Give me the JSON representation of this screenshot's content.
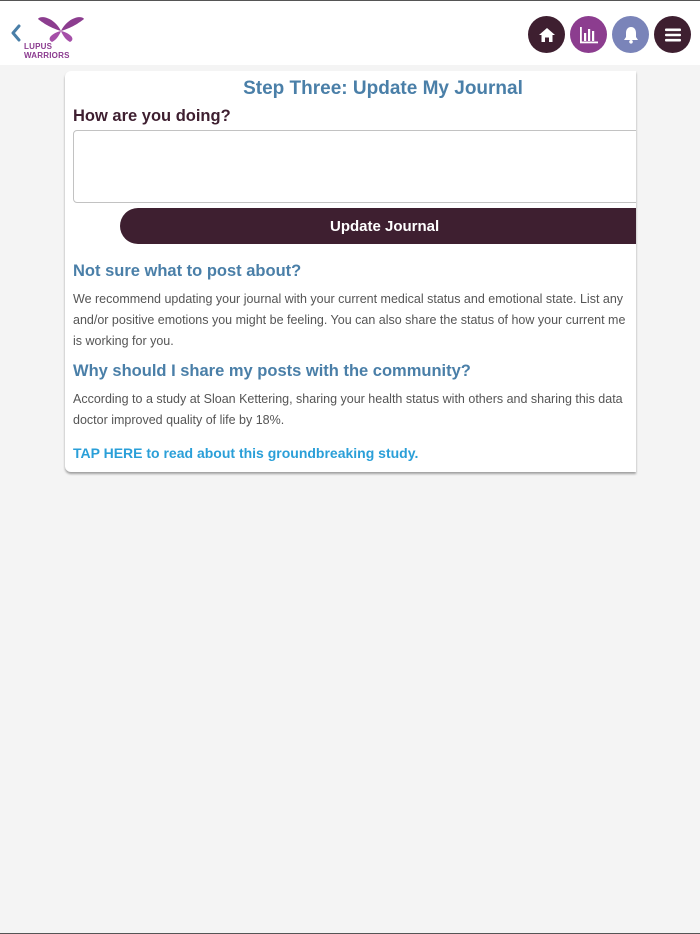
{
  "header": {
    "back_icon": "chevron-left-icon",
    "logo_text": "LUPUS WARRIORS",
    "nav": [
      {
        "icon": "home-icon",
        "color": "#3e1f30"
      },
      {
        "icon": "bar-chart-icon",
        "color": "#8c3d8f"
      },
      {
        "icon": "bell-icon",
        "color": "#7a84b9"
      },
      {
        "icon": "menu-icon",
        "color": "#3e1f30"
      }
    ]
  },
  "card": {
    "title": "Step Three: Update My Journal",
    "question": "How are you doing?",
    "input_value": "",
    "update_button": "Update Journal",
    "section1": {
      "heading": "Not sure what to post about?",
      "lines": [
        "We recommend updating your journal with your current medical status and emotional state. List any",
        "and/or positive emotions you might be feeling. You can also share the status of how your current me",
        "is working for you."
      ]
    },
    "section2": {
      "heading": "Why should I share my posts with the community?",
      "lines": [
        "According to a study at Sloan Kettering, sharing your health status with others and sharing this data",
        "doctor improved quality of life by 18%."
      ]
    },
    "link": "TAP HERE to read about this groundbreaking study."
  },
  "colors": {
    "accent_blue": "#4a7fa8",
    "dark_plum": "#3e1f30",
    "purple": "#8c3d8f",
    "lavender": "#7a84b9",
    "link_blue": "#2a9fd8"
  }
}
